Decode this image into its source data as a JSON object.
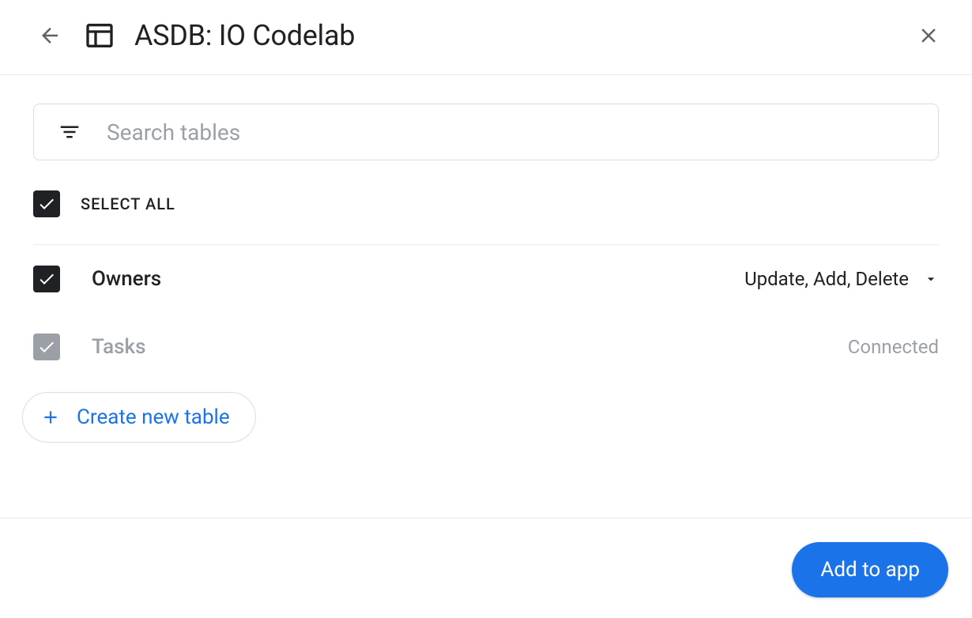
{
  "header": {
    "title": "ASDB: IO Codelab"
  },
  "search": {
    "placeholder": "Search tables"
  },
  "selectAll": {
    "label": "SELECT ALL",
    "checked": true
  },
  "tables": [
    {
      "name": "Owners",
      "checked": true,
      "disabled": false,
      "permissions": "Update, Add, Delete",
      "status": ""
    },
    {
      "name": "Tasks",
      "checked": true,
      "disabled": true,
      "permissions": "",
      "status": "Connected"
    }
  ],
  "createTable": {
    "label": "Create new table"
  },
  "footer": {
    "addButton": "Add to app"
  }
}
